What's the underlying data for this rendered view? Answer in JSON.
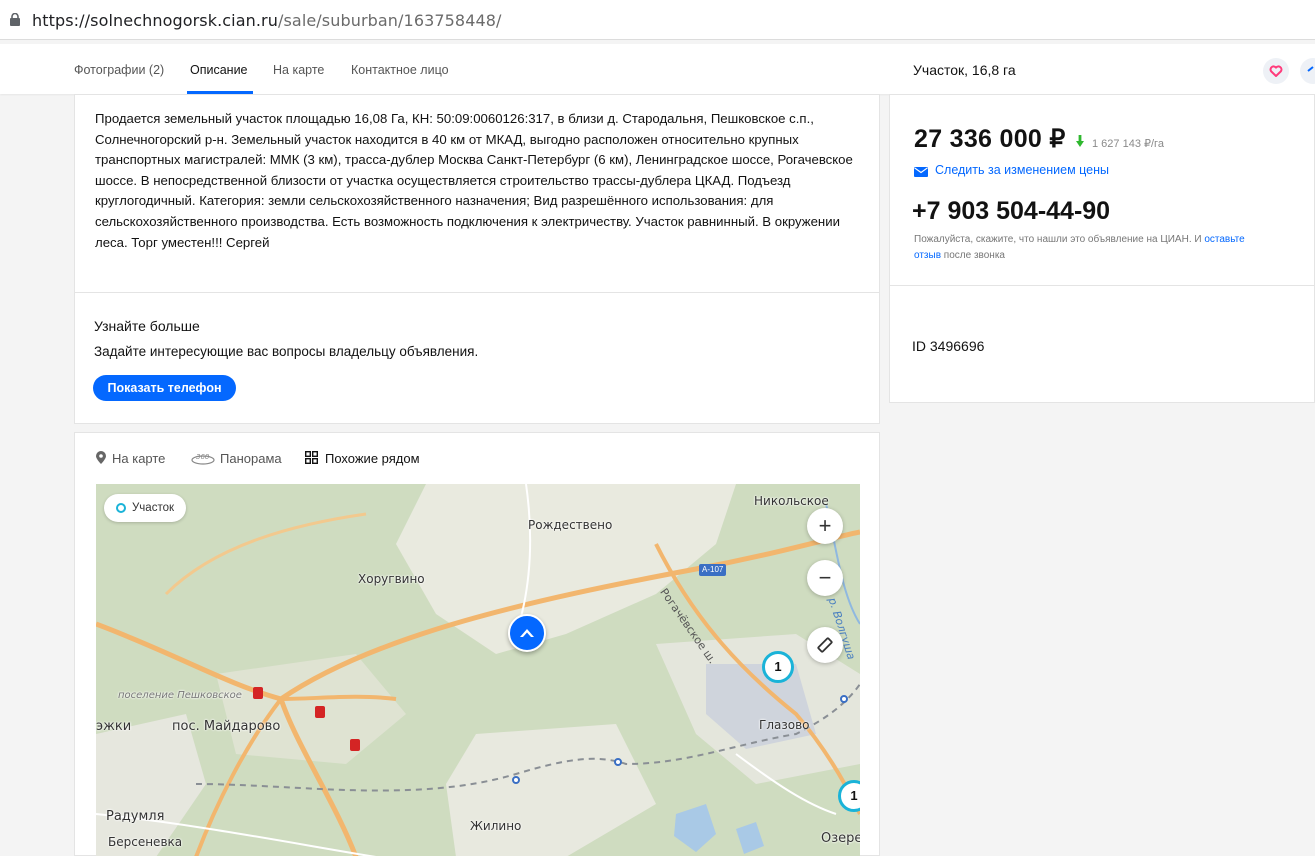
{
  "browser": {
    "url_host": "https://solnechnogorsk.cian.ru",
    "url_path": "/sale/suburban/163758448/"
  },
  "tabs": [
    {
      "label": "Фотографии (2)"
    },
    {
      "label": "Описание"
    },
    {
      "label": "На карте"
    },
    {
      "label": "Контактное лицо"
    }
  ],
  "active_tab": "Описание",
  "sidebar_title": "Участок, 16,8 га",
  "description": {
    "text": "Продается земельный участок площадью 16,08 Га, КН: 50:09:0060126:317, в близи д. Стародальня, Пешковское с.п., Солнечногорский р-н. Земельный участок находится в 40 км от МКАД, выгодно расположен относительно крупных транспортных магистралей: ММК (3 км), трасса-дублер Москва Санкт-Петербург (6 км), Ленинградское шоссе, Рогачевское шоссе. В непосредственной близости от участка осуществляется строительство трассы-дублера ЦКАД. Подъезд круглогодичный. Категория: земли сельскохозяйственного назначения; Вид разрешённого использования: для сельскохозяйственного производства. Есть возможность подключения к электричеству. Участок равнинный. В окружении леса. Торг уместен!!! Сергей"
  },
  "learn_more": {
    "title": "Узнайте больше",
    "subtitle": "Задайте интересующие вас вопросы владельцу объявления.",
    "button": "Показать телефон"
  },
  "map_section": {
    "tabs": [
      {
        "label": "На карте",
        "icon": "location-pin-icon"
      },
      {
        "label": "Панорама",
        "icon": "panorama-360-icon"
      },
      {
        "label": "Похожие рядом",
        "icon": "grid-icon"
      }
    ],
    "active_tab": "Похожие рядом",
    "legend": "Участок",
    "zoom_in": "+",
    "zoom_out": "−",
    "labels": {
      "nikolskoe": "Никольское",
      "rozhdestveno": "Рождествено",
      "khorugvino": "Хоругвино",
      "poselenie": "поселение Пешковское",
      "zhki": "эжки",
      "maydarovo": "пос. Майдарово",
      "glazovo": "Глазово",
      "radumlya": "Радумля",
      "berseneвka": "Берсеневка",
      "zhilino": "Жилино",
      "ozere": "Озере",
      "road_rogachevskoe": "Рогачёвское ш.",
      "river_volgusha": "р. Волгуша",
      "road_sign": "А-107"
    },
    "clusters": [
      "1",
      "1"
    ]
  },
  "price_block": {
    "price": "27 336 000 ₽",
    "price_per_unit": "1 627 143 ₽/га",
    "watch_price": "Следить за изменением цены",
    "phone": "+7 903 504-44-90",
    "note_before": "Пожалуйста, скажите, что нашли это объявление на ЦИАН. И ",
    "note_link1": "оставьте",
    "note_link2": "отзыв",
    "note_after": " после звонка",
    "listing_id": "ID 3496696"
  },
  "colors": {
    "accent": "#0468ff",
    "price_down": "#2fb82f",
    "favorite": "#ff3b7b",
    "map_bg": "#cfdcc0",
    "road": "#f2b66e"
  }
}
